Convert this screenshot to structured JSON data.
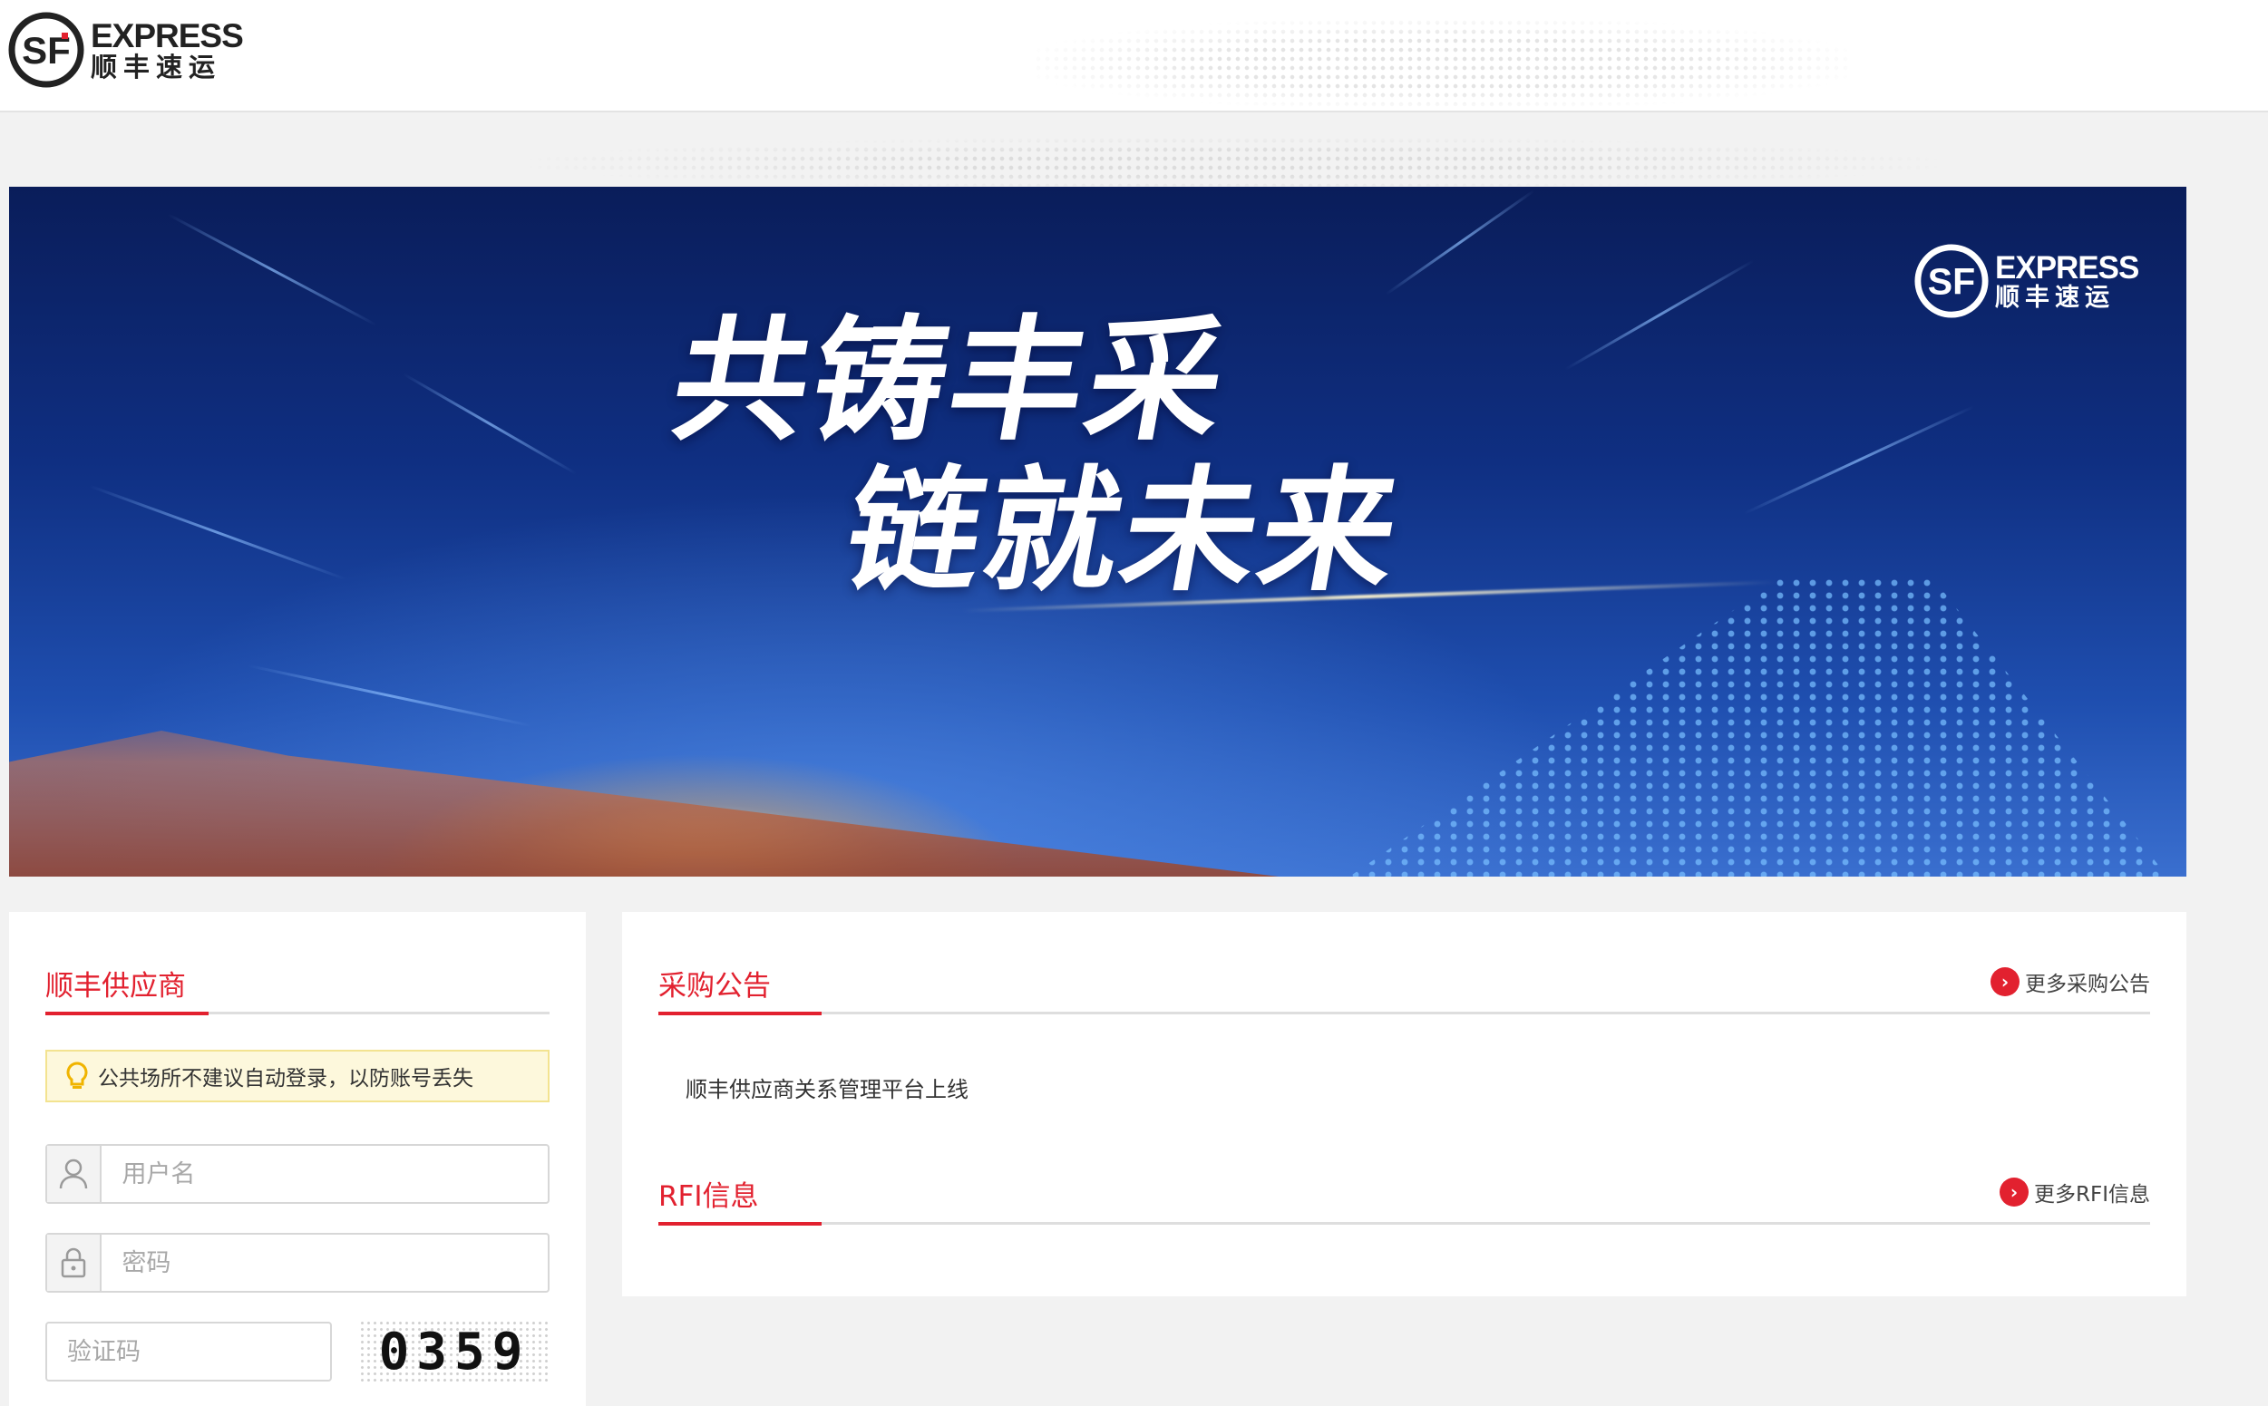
{
  "header": {
    "logo_en": "EXPRESS",
    "logo_cn": "顺丰速运"
  },
  "banner": {
    "line1": "共铸丰采",
    "line2": "链就未来",
    "logo_en": "EXPRESS",
    "logo_cn": "顺丰速运"
  },
  "login": {
    "title": "顺丰供应商",
    "notice": "公共场所不建议自动登录，以防账号丢失",
    "username_placeholder": "用户名",
    "password_placeholder": "密码",
    "captcha_placeholder": "验证码",
    "captcha_code": "0359"
  },
  "procurement": {
    "title": "采购公告",
    "more_label": "更多采购公告",
    "items": [
      "顺丰供应商关系管理平台上线"
    ]
  },
  "rfi": {
    "title": "RFI信息",
    "more_label": "更多RFI信息"
  },
  "colors": {
    "accent": "#e2212f",
    "notice_bg": "#fdf8dc",
    "page_bg": "#f2f2f2"
  }
}
